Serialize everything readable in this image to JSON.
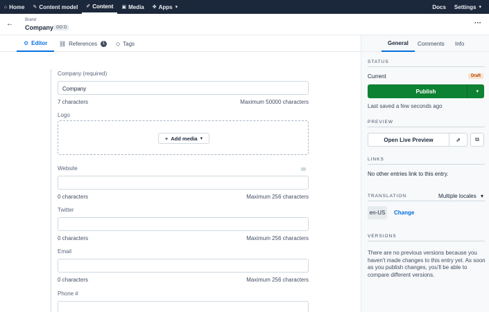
{
  "nav": {
    "items": [
      {
        "label": "Home",
        "icon": "home-icon"
      },
      {
        "label": "Content model",
        "icon": "wrench-icon"
      },
      {
        "label": "Content",
        "icon": "pen-icon",
        "active": true
      },
      {
        "label": "Media",
        "icon": "image-icon"
      },
      {
        "label": "Apps",
        "icon": "puzzle-icon"
      }
    ],
    "docs": "Docs",
    "settings": "Settings"
  },
  "entry": {
    "content_type": "Brand",
    "title": "Company",
    "badge": "GO D"
  },
  "tabs": {
    "editor": "Editor",
    "references": "References",
    "references_count": "1",
    "tags": "Tags"
  },
  "fields": {
    "company": {
      "label": "Company (required)",
      "value": "Company",
      "count": "7 characters",
      "max": "Maximum 50000 characters"
    },
    "logo": {
      "label": "Logo",
      "add_media": "Add media"
    },
    "website": {
      "label": "Website",
      "value": "",
      "count": "0 characters",
      "max": "Maximum 256 characters"
    },
    "twitter": {
      "label": "Twitter",
      "value": "",
      "count": "0 characters",
      "max": "Maximum 256 characters"
    },
    "email": {
      "label": "Email",
      "value": "",
      "count": "0 characters",
      "max": "Maximum 256 characters"
    },
    "phone": {
      "label": "Phone #",
      "value": ""
    }
  },
  "sidebar": {
    "tabs": [
      "General",
      "Comments",
      "Info"
    ],
    "status": {
      "heading": "STATUS",
      "current_label": "Current",
      "badge": "Draft",
      "publish": "Publish",
      "last_saved": "Last saved a few seconds ago"
    },
    "preview": {
      "heading": "PREVIEW",
      "button": "Open Live Preview"
    },
    "links": {
      "heading": "LINKS",
      "text": "No other entries link to this entry."
    },
    "translation": {
      "heading": "TRANSLATION",
      "mode": "Multiple locales",
      "locale": "en-US",
      "change": "Change"
    },
    "versions": {
      "heading": "VERSIONS",
      "text": "There are no previous versions because you haven't made changes to this entry yet. As soon as you publish changes, you'll be able to compare different versions."
    }
  },
  "colors": {
    "nav_bg": "#1b273a",
    "accent": "#036fe3",
    "publish": "#0e8233",
    "draft_badge": "#fce2cc"
  }
}
